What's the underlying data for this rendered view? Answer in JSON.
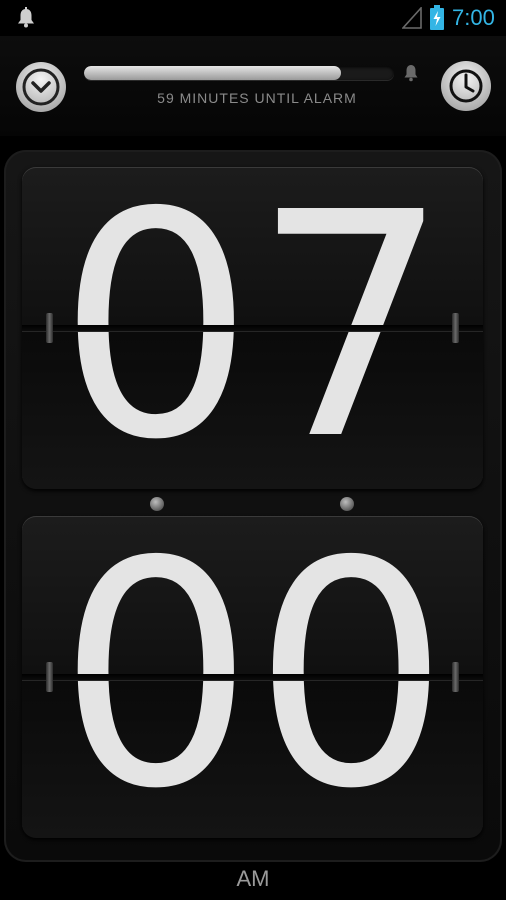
{
  "status_bar": {
    "time": "7:00",
    "time_color": "#33b5e5",
    "icons": [
      "notification-bell-icon",
      "signal-icon",
      "battery-charging-icon"
    ]
  },
  "alarm_panel": {
    "minutes_label": "59 MINUTES UNTIL ALARM",
    "progress_fraction": 0.83,
    "icons": [
      "collapse-chevron-icon",
      "alarm-bell-icon",
      "clock-icon"
    ]
  },
  "clock": {
    "hours": "07",
    "minutes": "00",
    "period": "AM"
  },
  "colors": {
    "digit": "#e4e4e4",
    "background": "#000000",
    "accent": "#33b5e5"
  }
}
